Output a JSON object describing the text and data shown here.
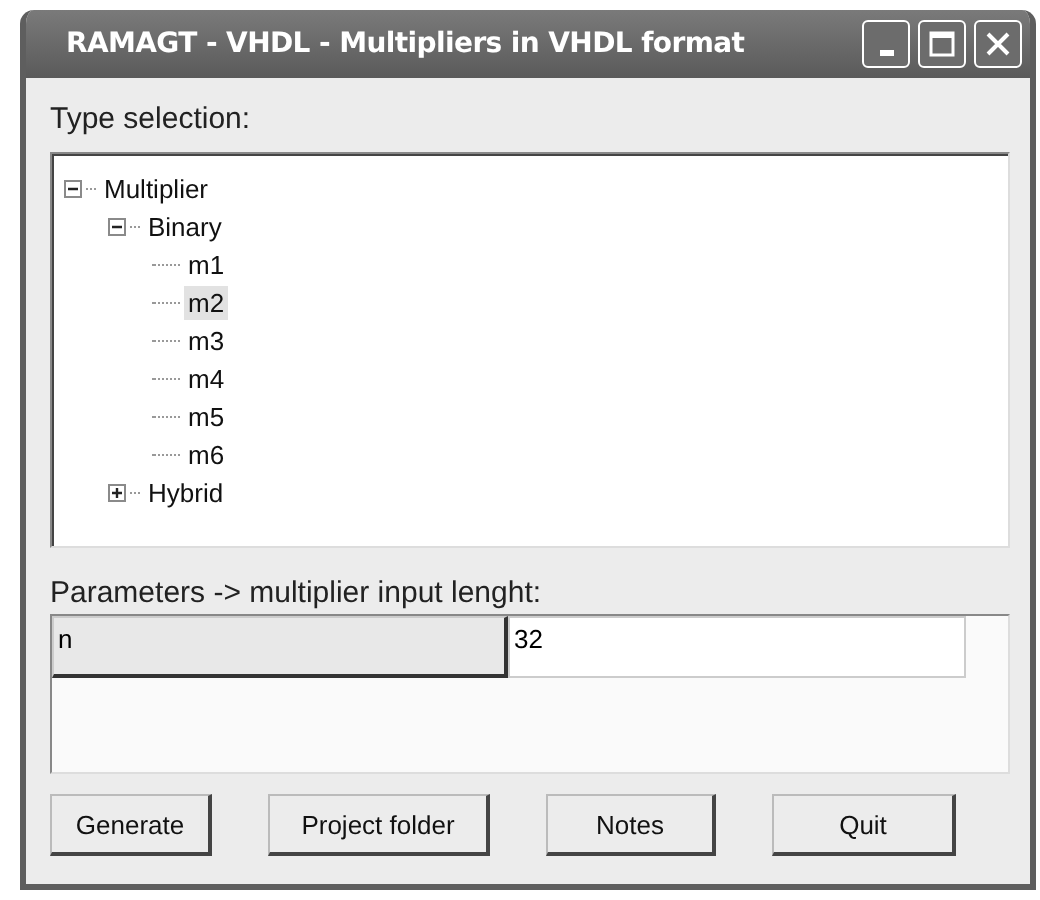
{
  "window": {
    "title": "RAMAGT - VHDL - Multipliers in VHDL format"
  },
  "type_label": "Type selection:",
  "tree": [
    {
      "label": "Multiplier",
      "expanded": true,
      "selected": false,
      "children": [
        {
          "label": "Binary",
          "expanded": true,
          "selected": false,
          "children": [
            {
              "label": "m1",
              "selected": false
            },
            {
              "label": "m2",
              "selected": true
            },
            {
              "label": "m3",
              "selected": false
            },
            {
              "label": "m4",
              "selected": false
            },
            {
              "label": "m5",
              "selected": false
            },
            {
              "label": "m6",
              "selected": false
            }
          ]
        },
        {
          "label": "Hybrid",
          "expanded": false,
          "selected": false
        }
      ]
    }
  ],
  "params_label": "Parameters -> multiplier input lenght:",
  "params": [
    {
      "name": "n",
      "value": "32"
    }
  ],
  "buttons": [
    "Generate",
    "Project folder",
    "Notes",
    "Quit"
  ]
}
